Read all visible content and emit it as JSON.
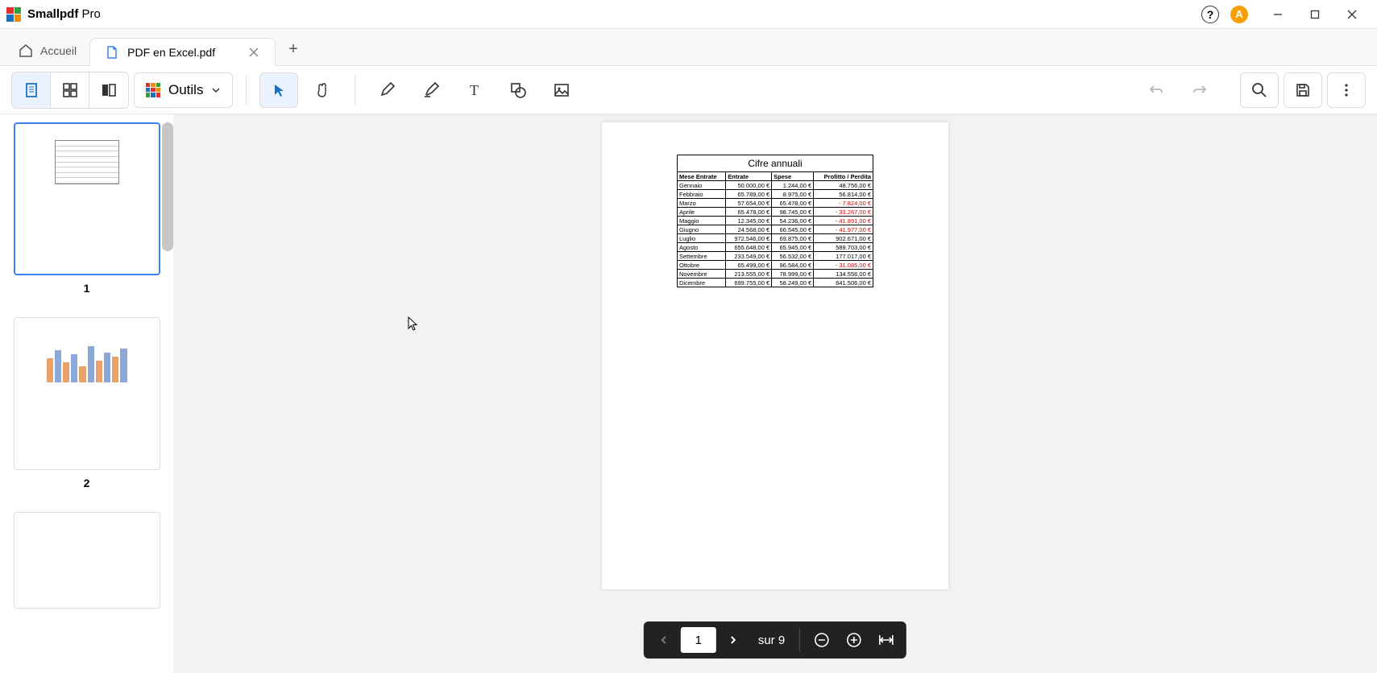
{
  "app": {
    "name_bold": "Smallpdf",
    "name_suffix": " Pro",
    "avatar_letter": "A",
    "help_label": "?"
  },
  "tabs": {
    "home_label": "Accueil",
    "file_tab": "PDF en Excel.pdf"
  },
  "toolbar": {
    "tools_label": "Outils"
  },
  "pagebar": {
    "current_page": "1",
    "total_label": "sur 9"
  },
  "thumbnails": {
    "p1": "1",
    "p2": "2"
  },
  "document": {
    "title": "Cifre annuali",
    "headers": {
      "c1": "Mese Entrate",
      "c2": "Entrate",
      "c3": "Spese",
      "c4": "Profitto / Perdita"
    },
    "rows": [
      {
        "m": "Gennaio",
        "e": "50.000,00 €",
        "s": "1.244,00 €",
        "p": "48.756,00 €",
        "neg": false
      },
      {
        "m": "Febbraio",
        "e": "65.789,00 €",
        "s": "8.975,00 €",
        "p": "56.814,00 €",
        "neg": false
      },
      {
        "m": "Marzo",
        "e": "57.654,00 €",
        "s": "65.478,00 €",
        "p": "7.824,00 €",
        "neg": true
      },
      {
        "m": "Aprile",
        "e": "65.478,00 €",
        "s": "98.745,00 €",
        "p": "33.267,00 €",
        "neg": true
      },
      {
        "m": "Maggio",
        "e": "12.345,00 €",
        "s": "54.236,00 €",
        "p": "41.891,00 €",
        "neg": true
      },
      {
        "m": "Giugno",
        "e": "24.568,00 €",
        "s": "66.545,00 €",
        "p": "41.977,00 €",
        "neg": true
      },
      {
        "m": "Luglio",
        "e": "972.546,00 €",
        "s": "69.875,00 €",
        "p": "902.671,00 €",
        "neg": false
      },
      {
        "m": "Agosto",
        "e": "655.648,00 €",
        "s": "65.945,00 €",
        "p": "589.703,00 €",
        "neg": false
      },
      {
        "m": "Settembre",
        "e": "233.549,00 €",
        "s": "56.532,00 €",
        "p": "177.017,00 €",
        "neg": false
      },
      {
        "m": "Ottobre",
        "e": "65.499,00 €",
        "s": "96.584,00 €",
        "p": "31.085,00 €",
        "neg": true
      },
      {
        "m": "Novembre",
        "e": "213.555,00 €",
        "s": "78.999,00 €",
        "p": "134.556,00 €",
        "neg": false
      },
      {
        "m": "Dicembre",
        "e": "699.755,00 €",
        "s": "58.249,00 €",
        "p": "641.506,00 €",
        "neg": false
      }
    ]
  }
}
